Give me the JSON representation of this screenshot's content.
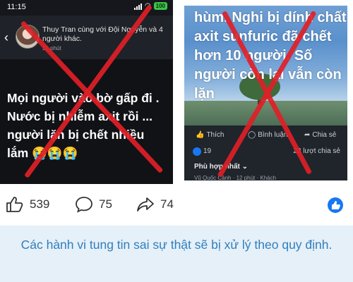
{
  "left_post": {
    "status_time": "11:15",
    "battery": "100",
    "author_line": "Thuy Tran cùng với Đội Nguyễn và 4 người khác.",
    "time": "31 phút",
    "body_text": "Mọi người vào bờ gấp đi . Nước bị nhiễm axit rồi ... người lặn bị chết nhiều lắm 😭😭😭"
  },
  "right_post": {
    "image_text": "hùm. Nghi bị dính chất axit sunfuric đã chết hơn 10 người. Số người còn lại vẫn còn lặn",
    "like_label": "Thích",
    "comment_label": "Bình luận",
    "share_label": "Chia sẻ",
    "reaction_count": "19",
    "share_count": "23 lượt chia sẻ",
    "sort_label": "Phù hợp nhất ⌄",
    "comment_snippet": "Vũ Quốc Cảnh · 12 phút · Khách"
  },
  "stats": {
    "likes": "539",
    "comments": "75",
    "shares": "74"
  },
  "caption": "Các hành vi tung tin sai sự thật sẽ bị xử lý theo quy định.",
  "colors": {
    "cross": "#e02027",
    "caption_text": "#2f7fbf",
    "caption_bg": "#e6f0f8",
    "fb_blue": "#1877f2"
  }
}
